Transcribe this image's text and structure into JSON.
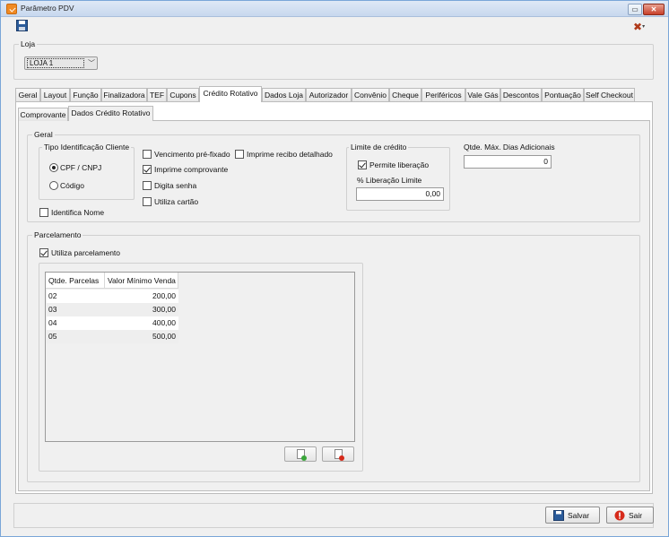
{
  "window": {
    "title": "Parâmetro PDV",
    "minimize": "▭",
    "close": "✕"
  },
  "loja": {
    "label": "Loja",
    "selected": "LOJA 1"
  },
  "tabs": [
    "Geral",
    "Layout",
    "Função",
    "Finalizadora",
    "TEF",
    "Cupons",
    "Crédito Rotativo",
    "Dados Loja",
    "Autorizador",
    "Convênio",
    "Cheque",
    "Periféricos",
    "Vale Gás",
    "Descontos",
    "Pontuação",
    "Self Checkout"
  ],
  "subtabs": [
    "Comprovante",
    "Dados Crédito Rotativo"
  ],
  "geral": {
    "title": "Geral",
    "tipo_id": {
      "title": "Tipo Identificação Cliente",
      "option1": "CPF / CNPJ",
      "option2": "Código"
    },
    "identifica_nome": "Identifica Nome",
    "vencimento": "Vencimento pré-fixado",
    "imprime_recibo": "Imprime recibo detalhado",
    "imprime_comprovante": "Imprime comprovante",
    "digita_senha": "Digita senha",
    "utiliza_cartao": "Utiliza cartão",
    "limite": {
      "title": "Limite de crédito",
      "permite": "Permite liberação",
      "pct_label": "% Liberação Limite",
      "pct_value": "0,00"
    },
    "dias": {
      "label": "Qtde. Máx. Dias Adicionais",
      "value": "0"
    }
  },
  "parcelamento": {
    "title": "Parcelamento",
    "utiliza": "Utiliza parcelamento",
    "columns": [
      "Qtde. Parcelas",
      "Valor Mínimo Venda"
    ],
    "rows": [
      [
        "02",
        "200,00"
      ],
      [
        "03",
        "300,00"
      ],
      [
        "04",
        "400,00"
      ],
      [
        "05",
        "500,00"
      ]
    ]
  },
  "footer": {
    "salvar": "Salvar",
    "sair": "Sair"
  },
  "colors": {
    "accent": "#f08a24",
    "add": "#3aa63a",
    "remove": "#d62a1a",
    "save": "#2a5b9a"
  }
}
